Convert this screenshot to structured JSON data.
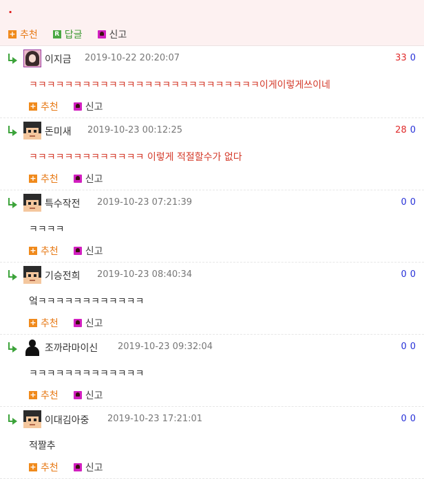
{
  "top": {
    "dot": ".",
    "recommend_label": "추천",
    "reply_label": "답글",
    "report_label": "신고",
    "reply_icon_letter": "R"
  },
  "comments": [
    {
      "nick": "이지금",
      "date": "2019-10-22 20:20:07",
      "up": "33",
      "down": "0",
      "text": "ㅋㅋㅋㅋㅋㅋㅋㅋㅋㅋㅋㅋㅋㅋㅋㅋㅋㅋㅋㅋㅋㅋㅋㅋㅋㅋ이게이렇게쓰이네",
      "avatar": "girl-photo",
      "text_color": "#d43a2a",
      "recommend": "추천",
      "report": "신고"
    },
    {
      "nick": "돈미새",
      "date": "2019-10-23 00:12:25",
      "up": "28",
      "down": "0",
      "text": "ㅋㅋㅋㅋㅋㅋㅋㅋㅋㅋㅋㅋㅋ 이렇게 적절할수가 없다",
      "avatar": "pixel-face",
      "text_color": "#d43a2a",
      "recommend": "추천",
      "report": "신고"
    },
    {
      "nick": "특수작전",
      "date": "2019-10-23 07:21:39",
      "up": "0",
      "down": "0",
      "text": "ㅋㅋㅋㅋ",
      "avatar": "pixel-face",
      "text_color": "#333333",
      "recommend": "추천",
      "report": "신고"
    },
    {
      "nick": "기승전희",
      "date": "2019-10-23 08:40:34",
      "up": "0",
      "down": "0",
      "text": "엌ㅋㅋㅋㅋㅋㅋㅋㅋㅋㅋㅋㅋ",
      "avatar": "pixel-face",
      "text_color": "#333333",
      "recommend": "추천",
      "report": "신고"
    },
    {
      "nick": "조까라마이신",
      "date": "2019-10-23 09:32:04",
      "up": "0",
      "down": "0",
      "text": "ㅋㅋㅋㅋㅋㅋㅋㅋㅋㅋㅋㅋㅋ",
      "avatar": "silhouette",
      "text_color": "#333333",
      "recommend": "추천",
      "report": "신고"
    },
    {
      "nick": "이대김아중",
      "date": "2019-10-23 17:21:01",
      "up": "0",
      "down": "0",
      "text": "적짤추",
      "avatar": "pixel-face",
      "text_color": "#333333",
      "recommend": "추천",
      "report": "신고"
    }
  ],
  "colors": {
    "recommend": "#e77a17",
    "reply": "#3e9a35",
    "upvote": "#e02b2b",
    "downvote": "#2630d8",
    "top_bg": "#fdf1f1"
  }
}
